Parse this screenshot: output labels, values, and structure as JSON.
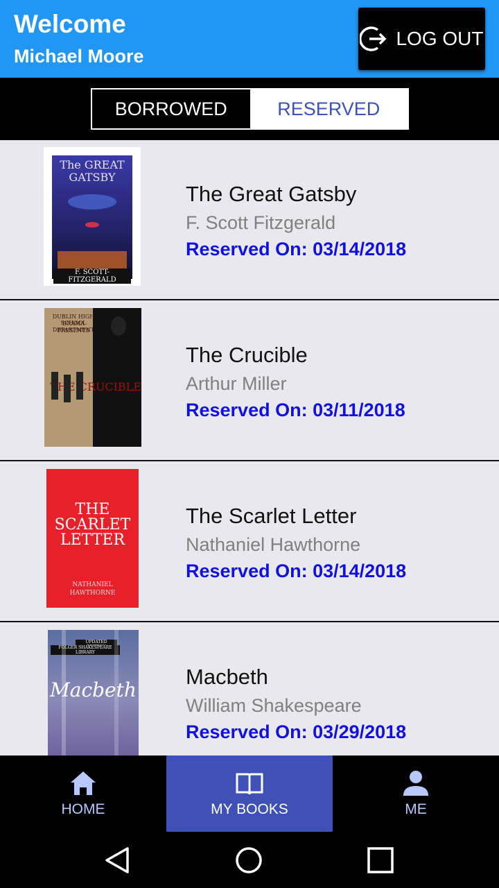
{
  "header": {
    "welcome": "Welcome",
    "username": "Michael Moore",
    "logout_label": "LOG OUT",
    "logout_icon": "logout-icon"
  },
  "tabs": {
    "borrowed": "BORROWED",
    "reserved": "RESERVED",
    "active": "reserved"
  },
  "books": [
    {
      "title": "The Great Gatsby",
      "author": "F. Scott Fitzgerald",
      "reserved": "Reserved On: 03/14/2018",
      "cover": {
        "line1": "The GREAT",
        "line2": "GATSBY",
        "footer": "F. SCOTT-FITZGERALD"
      }
    },
    {
      "title": "The Crucible",
      "author": "Arthur Miller",
      "reserved": "Reserved On: 03/11/2018",
      "cover": {
        "line1": "DUBLIN HIGH SCHOOL",
        "line2": "DRAMA DEPARTMENT",
        "line3": "PRESENTS",
        "big": "THE CRUCIBLE"
      }
    },
    {
      "title": "The Scarlet Letter",
      "author": "Nathaniel Hawthorne",
      "reserved": "Reserved On: 03/14/2018",
      "cover": {
        "line1": "THE",
        "line2": "SCARLET",
        "line3": "LETTER",
        "footer1": "NATHANIEL",
        "footer2": "HAWTHORNE"
      }
    },
    {
      "title": "Macbeth",
      "author": "William Shakespeare",
      "reserved": "Reserved On: 03/29/2018",
      "cover": {
        "line1": "UPDATED EDITION",
        "line2": "FOLGER SHAKESPEARE LIBRARY",
        "big": "Macbeth"
      }
    }
  ],
  "bottom_nav": [
    {
      "label": "HOME",
      "icon": "home-icon"
    },
    {
      "label": "MY BOOKS",
      "icon": "book-icon",
      "active": true
    },
    {
      "label": "ME",
      "icon": "person-icon"
    }
  ],
  "colors": {
    "header": "#2196f3",
    "accent": "#3f51b5",
    "reserved_text": "#1111dd",
    "list_bg": "#e8e8ee"
  }
}
